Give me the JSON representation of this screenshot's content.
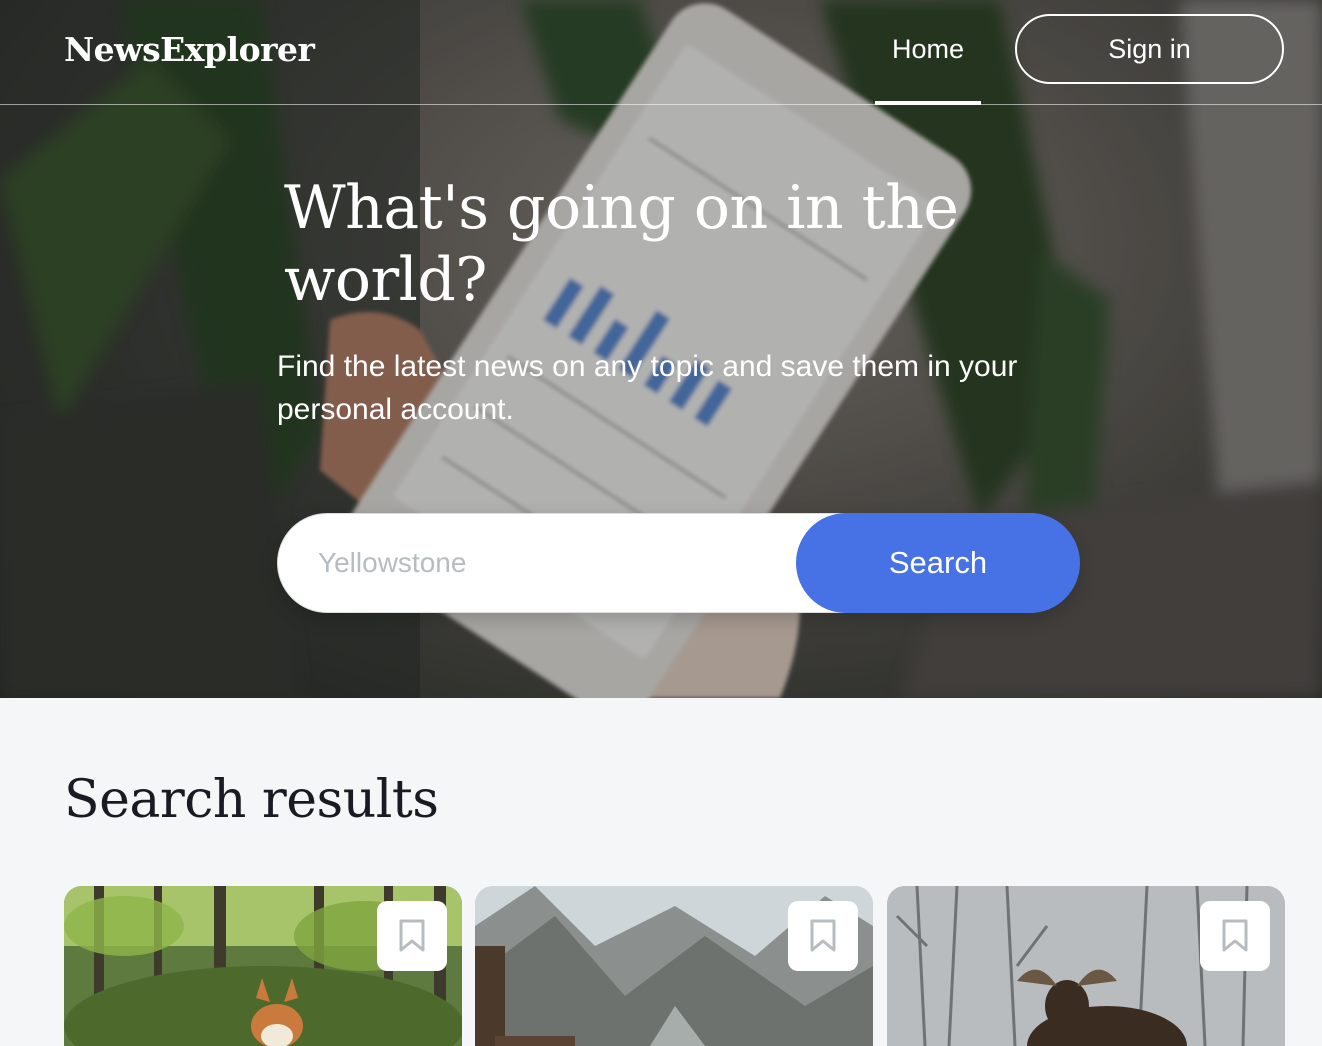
{
  "header": {
    "logo": "NewsExplorer",
    "nav_home": "Home",
    "signin_label": "Sign in"
  },
  "hero": {
    "title": "What's going on in the world?",
    "subtitle": "Find the latest news on any topic and save them in your personal account.",
    "search_placeholder": "Yellowstone",
    "search_button": "Search"
  },
  "results": {
    "title": "Search results",
    "cards": [
      {
        "image": "corgi-in-forest",
        "bookmark_icon": "bookmark-icon"
      },
      {
        "image": "mountain-valley",
        "bookmark_icon": "bookmark-icon"
      },
      {
        "image": "moose-in-winter-forest",
        "bookmark_icon": "bookmark-icon"
      }
    ]
  },
  "colors": {
    "accent": "#4672e5",
    "text_dark": "#1a1b22",
    "page_bg": "#f5f6f7",
    "placeholder": "#b6bcbf"
  }
}
